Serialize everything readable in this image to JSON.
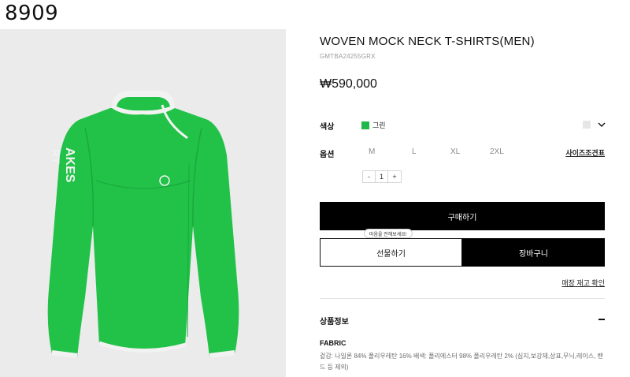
{
  "corner_label": "8909",
  "product": {
    "title": "WOVEN MOCK NECK T-SHIRTS(MEN)",
    "code": "GMTBA24255GRX",
    "price": "₩590,000"
  },
  "color": {
    "label": "색상",
    "selected_name": "그린",
    "swatch_color": "#1fb84a"
  },
  "options": {
    "label": "옵션",
    "sizes": [
      "M",
      "L",
      "XL",
      "2XL"
    ],
    "size_guide": "사이즈조견표"
  },
  "quantity": {
    "minus": "-",
    "value": "1",
    "plus": "+"
  },
  "buttons": {
    "buy": "구매하기",
    "gift_tooltip": "마음을 전해보세요!",
    "gift": "선물하기",
    "cart": "장바구니",
    "stock": "매장 재고 확인"
  },
  "details": {
    "section_title": "상품정보",
    "fabric_title": "FABRIC",
    "fabric_text": "겉감: 나일론 84% 폴리우레탄 16% 배색: 폴리에스터 98% 폴리우레탄 2% (심지,보강재,상표,무늬,레이스, 밴드 등 제외)"
  },
  "image": {
    "shirt_color": "#22c248",
    "trim_color": "#f2f2f2",
    "sleeve_text": "AKES\nRT"
  }
}
